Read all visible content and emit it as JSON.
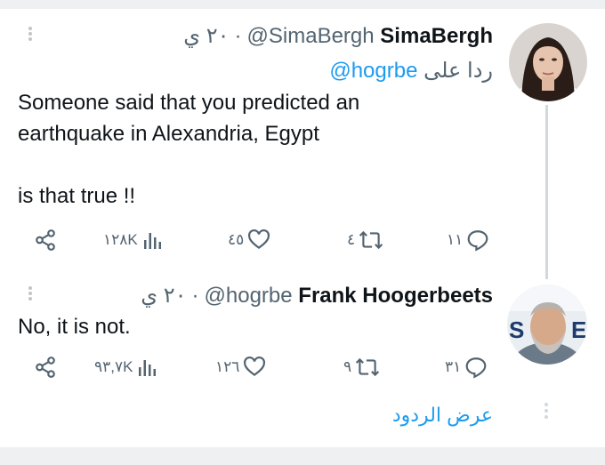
{
  "tweets": [
    {
      "display_name": "SimaBergh",
      "handle": "@SimaBergh",
      "time": "٢٠ ي",
      "reply_label": "ردا على",
      "reply_mention": "@hogrbe",
      "text": "Someone said that you predicted an\nearthquake in Alexandria, Egypt\n\nis that true !!",
      "stats": {
        "views": "١٢٨K",
        "likes": "٤٥",
        "retweets": "٤",
        "replies": "١١"
      }
    },
    {
      "display_name": "Frank Hoogerbeets",
      "handle": "@hogrbe",
      "time": "٢٠ ي",
      "text": "No, it is not.",
      "stats": {
        "views": "٩٣,٧K",
        "likes": "١٢٦",
        "retweets": "٩",
        "replies": "٣١"
      }
    }
  ],
  "separator": "·",
  "show_replies": "عرض الردود",
  "avatar_text": "S",
  "avatar_text_2": "E",
  "colors": {
    "accent": "#1d9bf0",
    "muted": "#536471",
    "text": "#0f1419"
  }
}
